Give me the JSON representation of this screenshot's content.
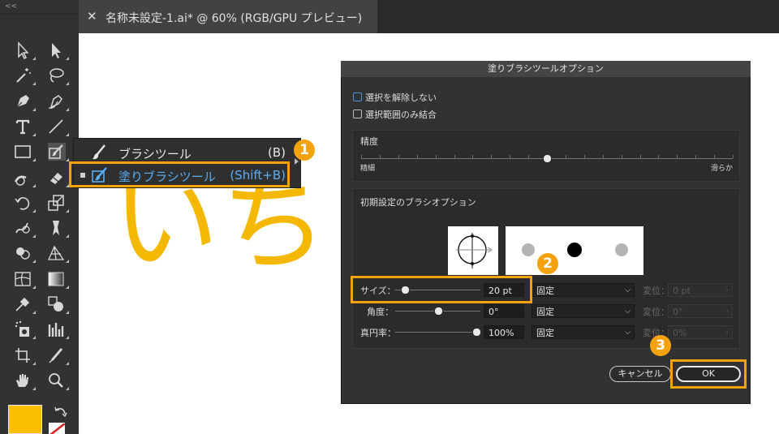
{
  "toolbar": {
    "collapse_label": "<<",
    "tools": [
      {
        "name": "selection-tool-icon"
      },
      {
        "name": "direct-selection-tool-icon"
      },
      {
        "name": "magic-wand-tool-icon"
      },
      {
        "name": "lasso-tool-icon"
      },
      {
        "name": "pen-tool-icon"
      },
      {
        "name": "curvature-tool-icon"
      },
      {
        "name": "type-tool-icon"
      },
      {
        "name": "line-segment-tool-icon"
      },
      {
        "name": "rectangle-tool-icon"
      },
      {
        "name": "blob-brush-tool-icon"
      },
      {
        "name": "shaper-tool-icon"
      },
      {
        "name": "eraser-tool-icon"
      },
      {
        "name": "rotate-tool-icon"
      },
      {
        "name": "scale-tool-icon"
      },
      {
        "name": "warp-tool-icon"
      },
      {
        "name": "puppet-warp-tool-icon"
      },
      {
        "name": "shape-builder-tool-icon"
      },
      {
        "name": "perspective-grid-tool-icon"
      },
      {
        "name": "mesh-tool-icon"
      },
      {
        "name": "gradient-tool-icon"
      },
      {
        "name": "eyedropper-tool-icon"
      },
      {
        "name": "blend-tool-icon"
      },
      {
        "name": "symbol-sprayer-tool-icon"
      },
      {
        "name": "column-graph-tool-icon"
      },
      {
        "name": "artboard-tool-icon"
      },
      {
        "name": "slice-tool-icon"
      },
      {
        "name": "hand-tool-icon"
      },
      {
        "name": "zoom-tool-icon"
      }
    ],
    "fill_color": "#fbbf00"
  },
  "tab": {
    "close_label": "✕",
    "title": "名称未設定-1.ai* @ 60% (RGB/GPU プレビュー)"
  },
  "canvas": {
    "text": "いちょ"
  },
  "flyout": {
    "items": [
      {
        "label": "ブラシツール",
        "shortcut": "(B)"
      },
      {
        "label": "塗りブラシツール",
        "shortcut": "(Shift+B)"
      }
    ]
  },
  "badges": {
    "b1": "1",
    "b2": "2",
    "b3": "3"
  },
  "accent_color": "#f5a20f",
  "dialog": {
    "title": "塗りブラシツールオプション",
    "keep_selected": {
      "label": "選択を解除しない",
      "checked": false
    },
    "merge_selection": {
      "label": "選択範囲のみ結合",
      "checked": false
    },
    "fidelity": {
      "title": "精度",
      "left_label": "精細",
      "right_label": "滑らか",
      "value": 0.5
    },
    "brush_options": {
      "title": "初期設定のブラシオプション",
      "size": {
        "label": "サイズ：",
        "value": "20 pt",
        "mode": "固定",
        "variation_label": "変位：",
        "variation_value": "0 pt"
      },
      "angle": {
        "label": "角度：",
        "value": "0°",
        "mode": "固定",
        "variation_label": "変位：",
        "variation_value": "0°"
      },
      "roundness": {
        "label": "真円率：",
        "value": "100%",
        "mode": "固定",
        "variation_label": "変位：",
        "variation_value": "0%"
      }
    },
    "cancel_label": "キャンセル",
    "ok_label": "OK"
  }
}
